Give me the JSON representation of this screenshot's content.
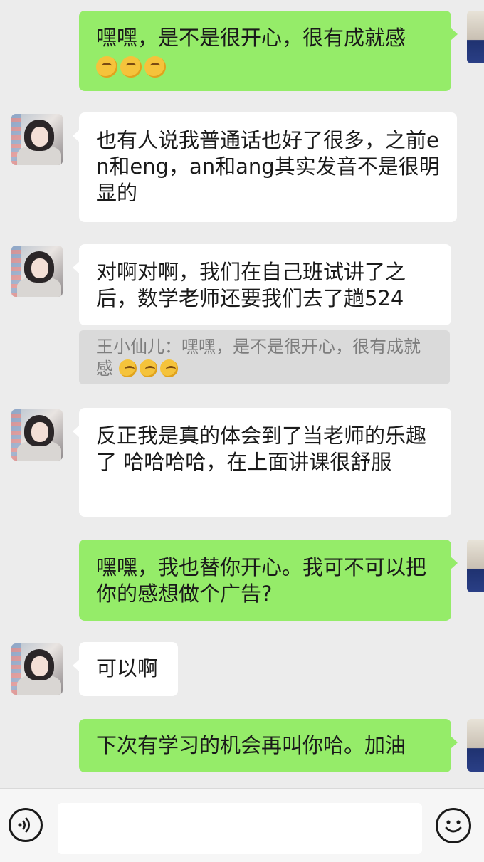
{
  "messages": [
    {
      "side": "right",
      "text": "嘿嘿，是不是很开心，很有成就感",
      "emoji_count": 3
    },
    {
      "side": "left",
      "text": "也有人说我普通话也好了很多，之前en和eng，an和ang其实发音不是很明显的"
    },
    {
      "side": "left",
      "text": "对啊对啊，我们在自己班试讲了之后，数学老师还要我们去了趟524",
      "quote": {
        "text": "王小仙儿：嘿嘿，是不是很开心，很有成就感",
        "emoji_count": 3
      }
    },
    {
      "side": "left",
      "text": "反正我是真的体会到了当老师的乐趣了 哈哈哈哈，在上面讲课很舒服"
    },
    {
      "side": "right",
      "text": "嘿嘿，我也替你开心。我可不可以把你的感想做个广告?"
    },
    {
      "side": "left",
      "text": "可以啊"
    },
    {
      "side": "right",
      "text": "下次有学习的机会再叫你哈。加油"
    }
  ],
  "icons": {
    "voice": "voice-icon",
    "emoji": "emoji-icon",
    "reaction_emoji": "thinking-face-emoji"
  },
  "colors": {
    "background": "#ececec",
    "sent_bubble": "#95ec69",
    "received_bubble": "#ffffff",
    "quote_bg": "#dadada"
  }
}
